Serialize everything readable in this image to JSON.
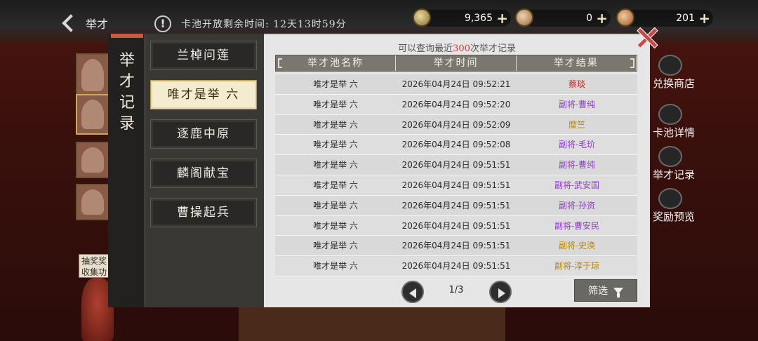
{
  "header": {
    "back_label": "举才",
    "info_icon": "!",
    "pool_timer": "卡池开放剩余时间: 12天13时59分",
    "resources": [
      {
        "icon": "coin-icon",
        "value": "9,365",
        "plus": "+"
      },
      {
        "icon": "gem-icon",
        "value": "0",
        "plus": "+"
      },
      {
        "icon": "token-icon",
        "value": "201",
        "plus": "+"
      }
    ]
  },
  "background": {
    "hint_text": "抽奖奖 收集功",
    "side_buttons": [
      {
        "label": "兑换商店",
        "icon": "shop-icon"
      },
      {
        "label": "卡池详情",
        "icon": "magnifier-icon"
      },
      {
        "label": "举才记录",
        "icon": "brush-icon"
      },
      {
        "label": "奖励预览",
        "icon": "preview-icon"
      }
    ]
  },
  "modal": {
    "title": "举才记录",
    "tabs": [
      {
        "label": "兰棹问莲",
        "active": false
      },
      {
        "label": "唯才是举 六",
        "active": true
      },
      {
        "label": "逐鹿中原",
        "active": false
      },
      {
        "label": "麟阁献宝",
        "active": false
      },
      {
        "label": "曹操起兵",
        "active": false
      }
    ],
    "notice_prefix": "可以查询最近",
    "notice_count": "300",
    "notice_suffix": "次举才记录",
    "columns": [
      "举才池名称",
      "举才时间",
      "举才结果"
    ],
    "rows": [
      {
        "pool": "唯才是举 六",
        "time": "2026年04月24日 09:52:21",
        "result": "蔡琰",
        "color": "#c8241e"
      },
      {
        "pool": "唯才是举 六",
        "time": "2026年04月24日 09:52:20",
        "result": "副将-曹纯",
        "color": "#8a3fc4"
      },
      {
        "pool": "唯才是举 六",
        "time": "2026年04月24日 09:52:09",
        "result": "糜竺",
        "color": "#b8860b"
      },
      {
        "pool": "唯才是举 六",
        "time": "2026年04月24日 09:52:08",
        "result": "副将-毛玠",
        "color": "#8a3fc4"
      },
      {
        "pool": "唯才是举 六",
        "time": "2026年04月24日 09:51:51",
        "result": "副将-曹纯",
        "color": "#8a3fc4"
      },
      {
        "pool": "唯才是举 六",
        "time": "2026年04月24日 09:51:51",
        "result": "副将-武安国",
        "color": "#8a3fc4"
      },
      {
        "pool": "唯才是举 六",
        "time": "2026年04月24日 09:51:51",
        "result": "副将-孙资",
        "color": "#8a3fc4"
      },
      {
        "pool": "唯才是举 六",
        "time": "2026年04月24日 09:51:51",
        "result": "副将-曹安民",
        "color": "#8a3fc4"
      },
      {
        "pool": "唯才是举 六",
        "time": "2026年04月24日 09:51:51",
        "result": "副将-史涣",
        "color": "#b8860b"
      },
      {
        "pool": "唯才是举 六",
        "time": "2026年04月24日 09:51:51",
        "result": "副将-淳于琼",
        "color": "#b8860b"
      }
    ],
    "pager": "1/3",
    "filter_label": "筛选"
  }
}
